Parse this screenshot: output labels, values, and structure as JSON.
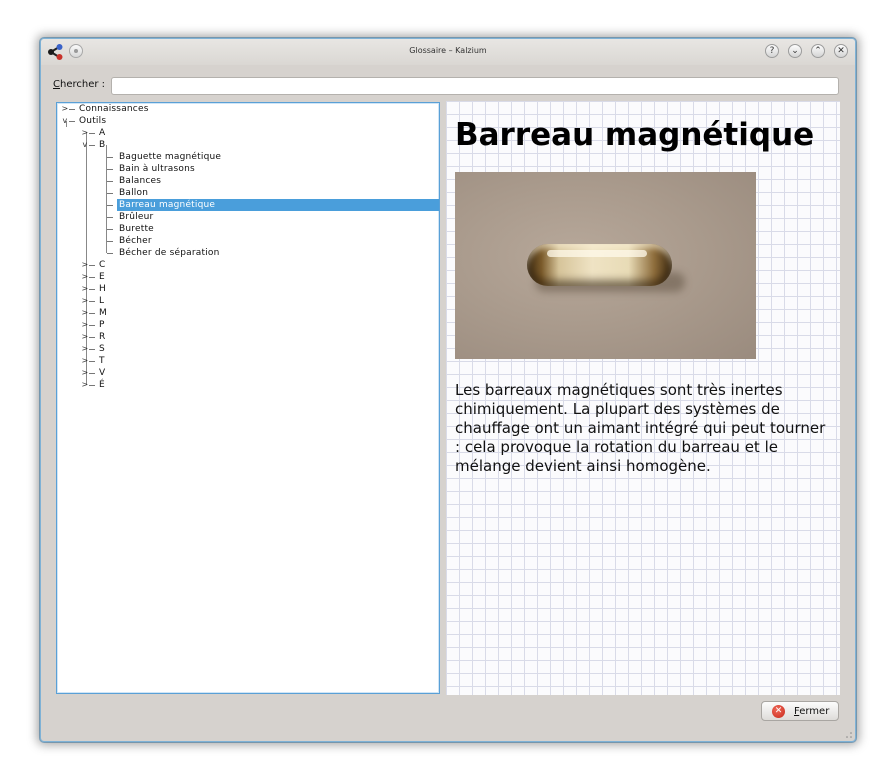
{
  "window": {
    "title": "Glossaire – Kalzium",
    "controls": [
      "?",
      "⌄",
      "⌃",
      "✕"
    ]
  },
  "search": {
    "label_mnemonic": "C",
    "label_rest": "hercher :",
    "value": "",
    "placeholder": ""
  },
  "tree": {
    "root": [
      {
        "label": "Connaissances",
        "expanded": false
      },
      {
        "label": "Outils",
        "expanded": true
      }
    ],
    "letters_before": [
      {
        "label": "A",
        "expanded": false
      },
      {
        "label": "B",
        "expanded": true
      }
    ],
    "b_items": [
      "Baguette magnétique",
      "Bain à ultrasons",
      "Balances",
      "Ballon",
      "Barreau magnétique",
      "Brûleur",
      "Burette",
      "Bécher",
      "Bécher de séparation"
    ],
    "selected": "Barreau magnétique",
    "letters_after": [
      "C",
      "E",
      "H",
      "L",
      "M",
      "P",
      "R",
      "S",
      "T",
      "V",
      "É"
    ]
  },
  "detail": {
    "title": "Barreau magnétique",
    "description": "Les barreaux magnétiques sont très inertes chimiquement. La plupart des systèmes de chauffage ont un aimant intégré qui peut tourner : cela provoque la rotation du barreau et le mélange devient ainsi homogène."
  },
  "footer": {
    "close_mnemonic": "F",
    "close_rest": "ermer",
    "close_icon": "close-icon"
  },
  "colors": {
    "selection": "#4a9edb",
    "focus_border": "#5aa0d6",
    "close_icon": "#d9362a"
  }
}
